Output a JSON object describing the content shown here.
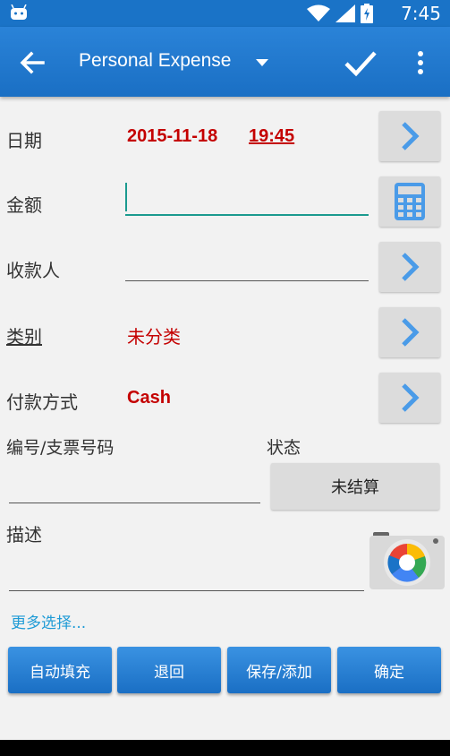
{
  "status_bar": {
    "time": "7:45"
  },
  "app_bar": {
    "title": "Personal Expense"
  },
  "form": {
    "date_label": "日期",
    "date_value": "2015-11-18",
    "time_value": "19:45",
    "amount_label": "金额",
    "amount_value": "",
    "payee_label": "收款人",
    "payee_value": "",
    "category_label": "类别",
    "category_value": "未分类",
    "payment_label": "付款方式",
    "payment_value": "Cash",
    "number_label": "编号/支票号码",
    "number_value": "",
    "status_label": "状态",
    "status_value": "未结算",
    "description_label": "描述",
    "description_value": "",
    "more_options": "更多选择..."
  },
  "buttons": {
    "autofill": "自动填充",
    "back": "退回",
    "save_add": "保存/添加",
    "confirm": "确定"
  },
  "colors": {
    "app_bar": "#1a73c7",
    "accent_red": "#c40000",
    "teal": "#1b9a8f",
    "link": "#1f9bd6",
    "chevron": "#4a9be8"
  }
}
